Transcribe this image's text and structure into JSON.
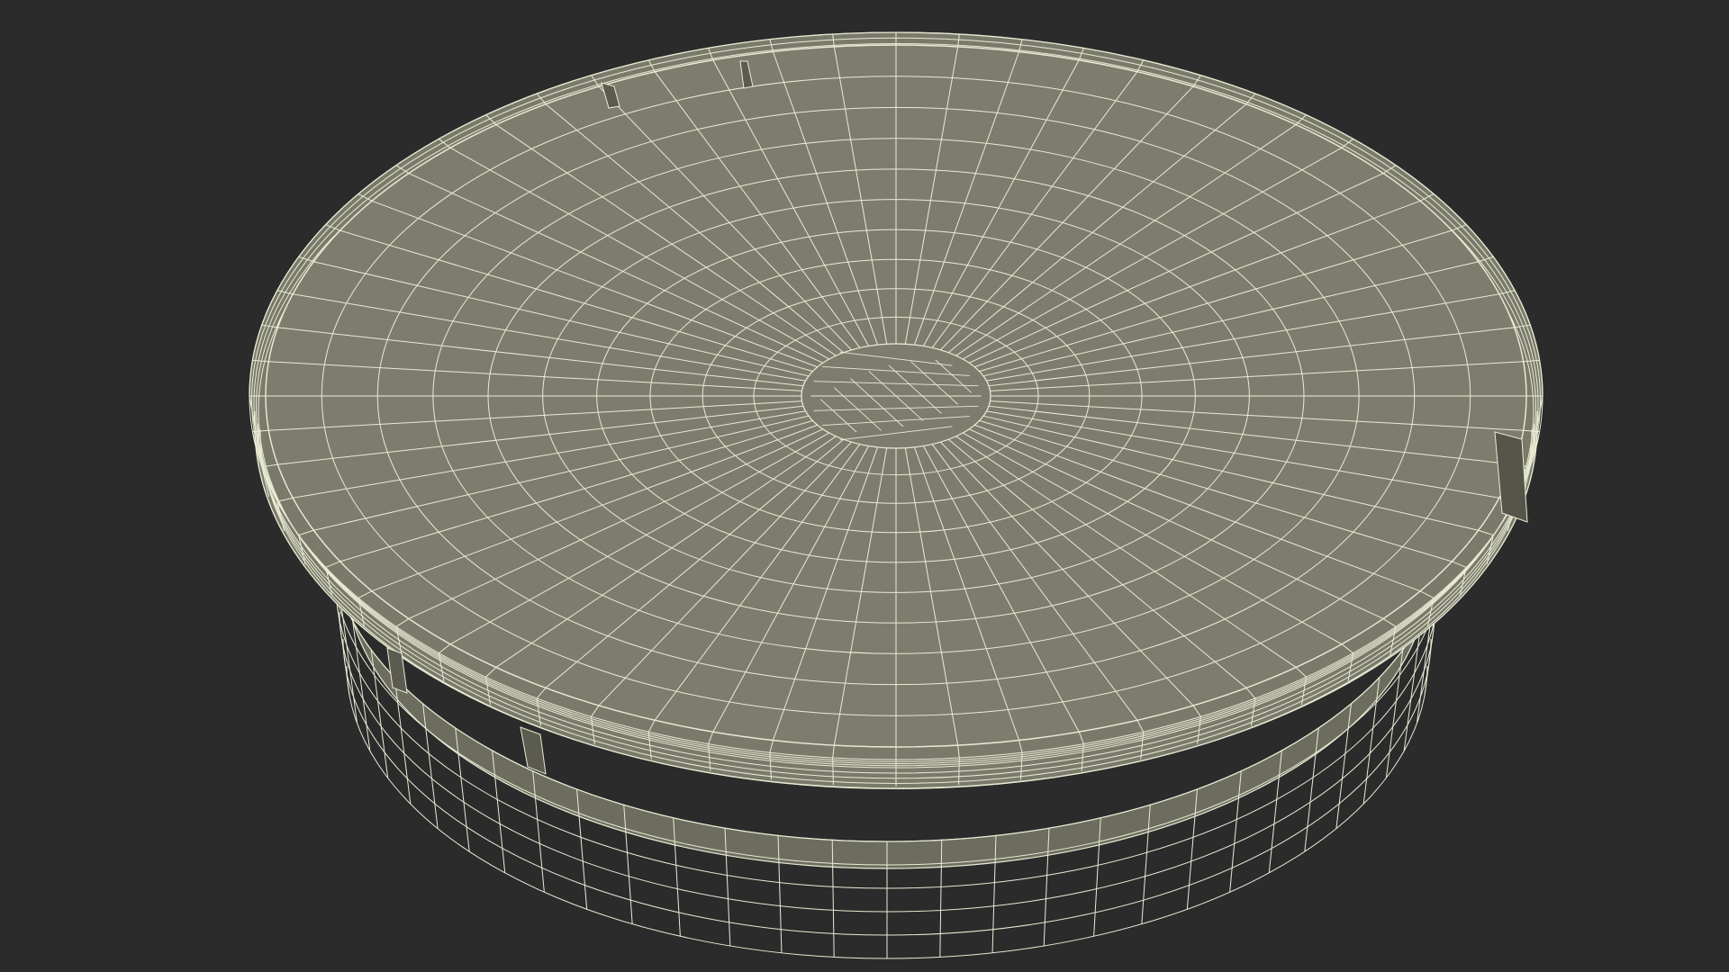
{
  "scene": {
    "background_color": "#2b2b2b",
    "mesh_fill_color": "#7d7d6e",
    "mesh_shade_color": "#6d6d5f",
    "wire_color": "#e9ebd4",
    "object": "round-container-lid-wireframe",
    "radial_segments": 64,
    "concentric_rings": 10,
    "rim_rows": 4,
    "side_rows": 5
  }
}
